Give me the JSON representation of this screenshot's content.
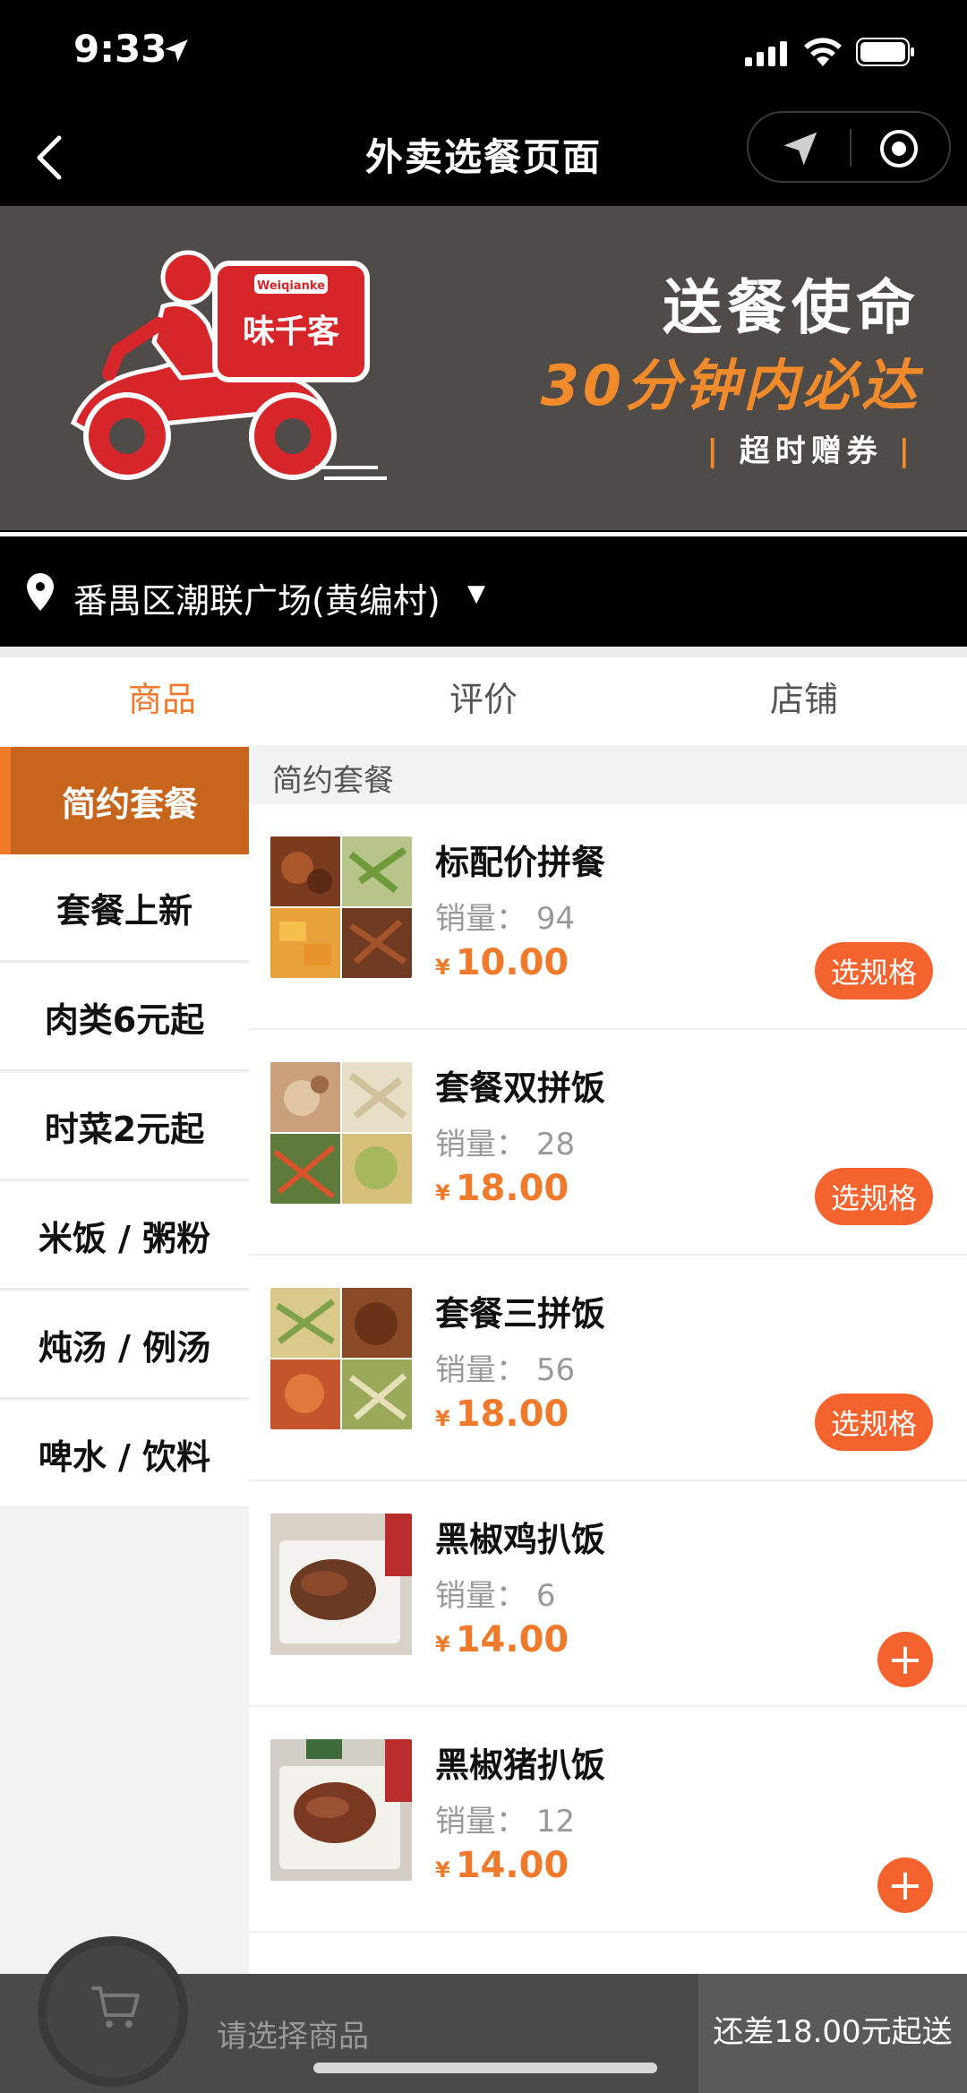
{
  "status_bar": {
    "time": "9:33"
  },
  "nav": {
    "title": "外卖选餐页面"
  },
  "banner": {
    "logo_text": "味千客",
    "logo_brand": "Weiqianke",
    "slogan_main": "送餐使命",
    "slogan_promise": "30分钟内必达",
    "slogan_guarantee": "超时赠券"
  },
  "address": {
    "text": "番禺区潮联广场(黄编村)",
    "dropdown": "▼"
  },
  "tabs": [
    {
      "label": "商品",
      "active": true
    },
    {
      "label": "评价",
      "active": false
    },
    {
      "label": "店铺",
      "active": false
    }
  ],
  "sidebar": {
    "items": [
      {
        "label": "简约套餐",
        "active": true
      },
      {
        "label": "套餐上新",
        "active": false
      },
      {
        "label": "肉类6元起",
        "active": false
      },
      {
        "label": "时菜2元起",
        "active": false
      },
      {
        "label": "米饭 / 粥粉",
        "active": false
      },
      {
        "label": "炖汤 / 例汤",
        "active": false
      },
      {
        "label": "啤水 / 饮料",
        "active": false
      }
    ]
  },
  "section": {
    "title": "简约套餐"
  },
  "products": [
    {
      "name": "标配价拼餐",
      "sales_label": "销量：",
      "sales": "94",
      "currency": "¥",
      "price": "10.00",
      "action": "选规格"
    },
    {
      "name": "套餐双拼饭",
      "sales_label": "销量：",
      "sales": "28",
      "currency": "¥",
      "price": "18.00",
      "action": "选规格"
    },
    {
      "name": "套餐三拼饭",
      "sales_label": "销量：",
      "sales": "56",
      "currency": "¥",
      "price": "18.00",
      "action": "选规格"
    },
    {
      "name": "黑椒鸡扒饭",
      "sales_label": "销量：",
      "sales": "6",
      "currency": "¥",
      "price": "14.00",
      "action": "+"
    },
    {
      "name": "黑椒猪扒饭",
      "sales_label": "销量：",
      "sales": "12",
      "currency": "¥",
      "price": "14.00",
      "action": "+"
    }
  ],
  "cart": {
    "hint": "请选择商品",
    "min_order": "还差18.00元起送"
  },
  "colors": {
    "accent": "#f07a2c",
    "button": "#f4632e",
    "sidebar_active": "#c8651c",
    "banner_bg": "#4e4b49",
    "logo_red": "#d6262a"
  }
}
